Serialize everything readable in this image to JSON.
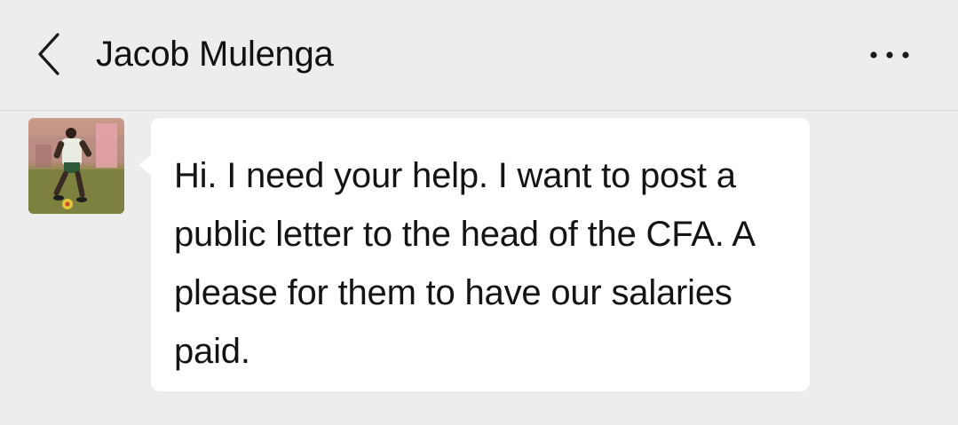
{
  "header": {
    "title": "Jacob Mulenga",
    "back_icon": "chevron-left-icon",
    "more_icon": "more-dots-icon"
  },
  "conversation": {
    "messages": [
      {
        "sender": "contact",
        "text": "Hi. I need your help. I want to post a public letter to the head of the CFA. A please for them to have our salaries paid."
      }
    ]
  },
  "colors": {
    "background": "#ededed",
    "bubble": "#ffffff",
    "text": "#141414"
  }
}
